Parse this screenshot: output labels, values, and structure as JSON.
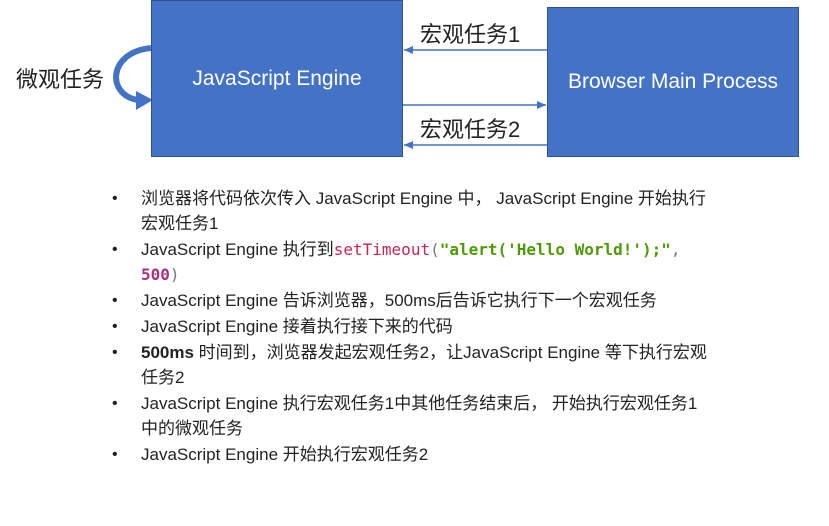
{
  "diagram": {
    "engine_box": "JavaScript Engine",
    "browser_box": "Browser Main Process",
    "macro_task_1": "宏观任务1",
    "macro_task_2": "宏观任务2",
    "micro_task": "微观任务"
  },
  "notes": {
    "item1": "浏览器将代码依次传入 JavaScript Engine 中， JavaScript Engine 开始执行宏观任务1",
    "item2_prefix": "JavaScript Engine 执行到",
    "item2_code_fn": "setTimeout",
    "item2_code_open": "(",
    "item2_code_str": "\"alert('Hello World!');\"",
    "item2_code_comma": ", ",
    "item2_code_num": "500",
    "item2_code_close": ")",
    "item3": "JavaScript Engine 告诉浏览器，500ms后告诉它执行下一个宏观任务",
    "item4": "JavaScript Engine 接着执行接下来的代码",
    "item5_bold": "500ms",
    "item5_rest": " 时间到，浏览器发起宏观任务2，让JavaScript Engine 等下执行宏观任务2",
    "item6": "JavaScript Engine 执行宏观任务1中其他任务结束后， 开始执行宏观任务1中的微观任务",
    "item7": "JavaScript Engine 开始执行宏观任务2"
  },
  "colors": {
    "box_fill": "#4472C4",
    "arrow": "#4472C4",
    "code_function": "#c7254e",
    "code_string": "#4e9a06"
  }
}
